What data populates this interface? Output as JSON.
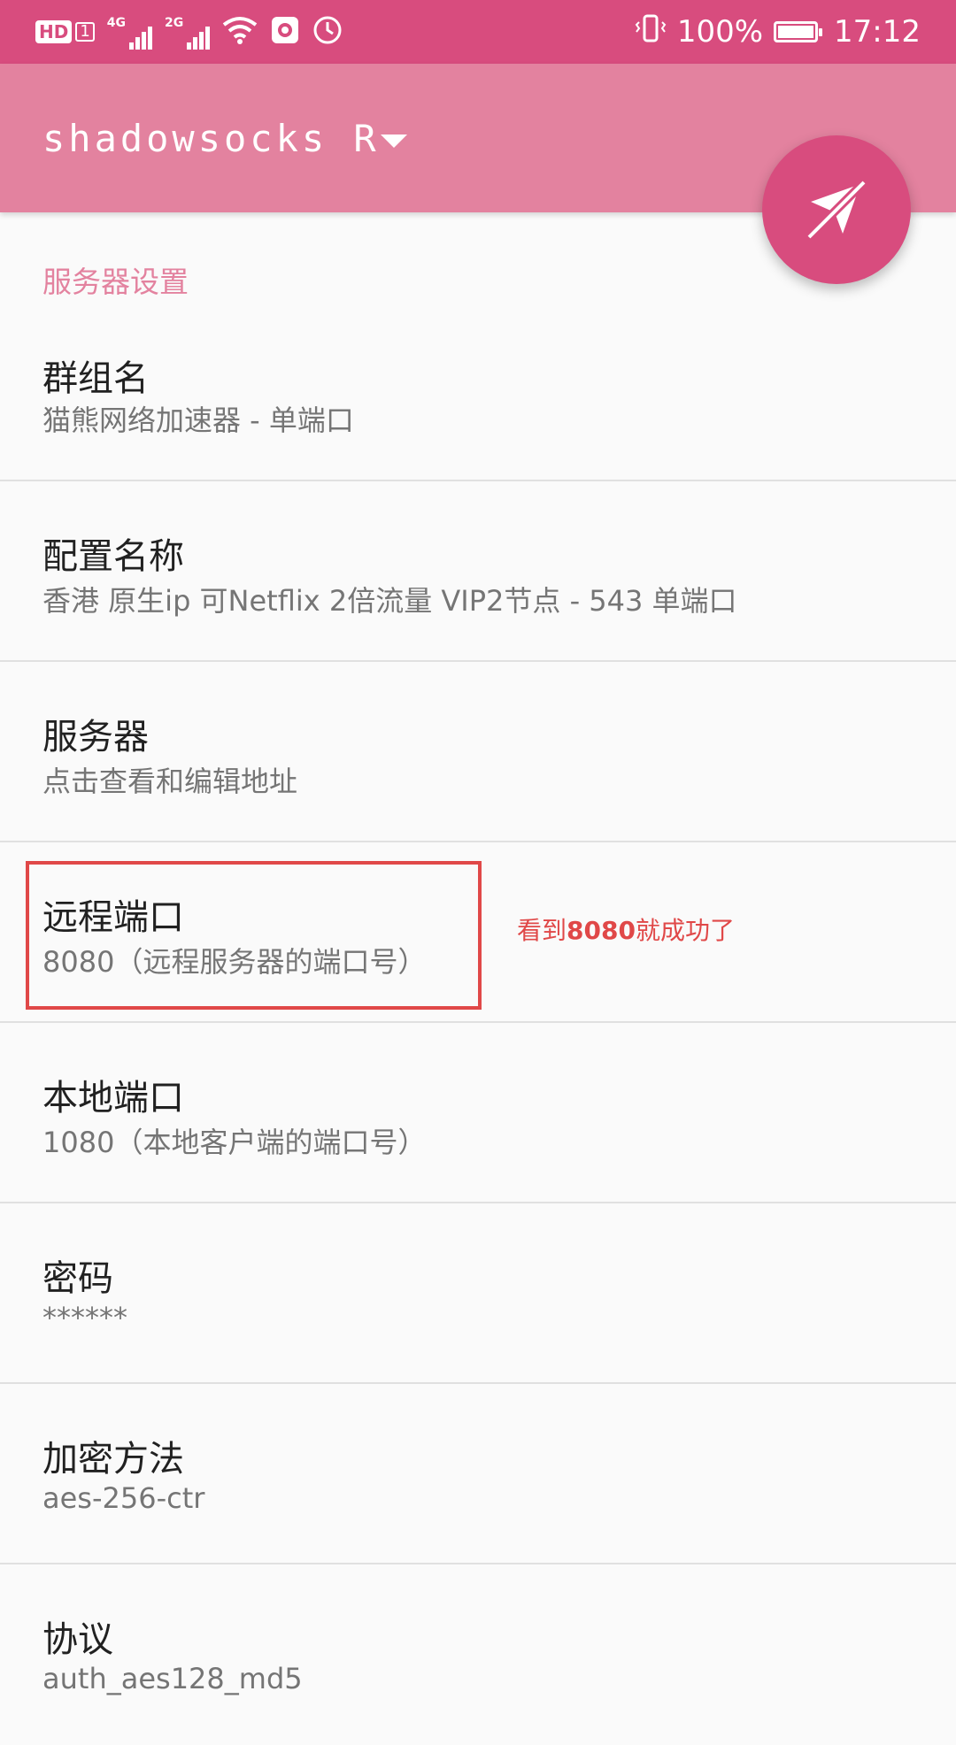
{
  "status_bar": {
    "hd": "HD",
    "hd_sub": "1",
    "net1": "4G",
    "net2": "2G",
    "battery": "100%",
    "time": "17:12",
    "battery_level": 1.0
  },
  "toolbar": {
    "title": "shadowsocks R"
  },
  "section": {
    "title": "服务器设置"
  },
  "items": [
    {
      "title": "群组名",
      "summary": "猫熊网络加速器 - 单端口"
    },
    {
      "title": "配置名称",
      "summary": "香港 原生ip 可Netflix 2倍流量 VIP2节点 - 543 单端口"
    },
    {
      "title": "服务器",
      "summary": "点击查看和编辑地址"
    },
    {
      "title": "远程端口",
      "summary": "8080（远程服务器的端口号）"
    },
    {
      "title": "本地端口",
      "summary": "1080（本地客户端的端口号）"
    },
    {
      "title": "密码",
      "summary": "******"
    },
    {
      "title": "加密方法",
      "summary": "aes-256-ctr"
    },
    {
      "title": "协议",
      "summary": "auth_aes128_md5"
    }
  ],
  "annotation": {
    "prefix": "看到",
    "strong": "8080",
    "suffix": "就成功了"
  },
  "colors": {
    "status_bar": "#d84c7e",
    "toolbar": "#e3829f",
    "fab": "#d84c7e",
    "accent_text": "#e3829f",
    "annotation": "#e04848"
  },
  "icons": {
    "fab": "paper-plane-off-icon",
    "dropdown": "triangle-down-icon"
  }
}
